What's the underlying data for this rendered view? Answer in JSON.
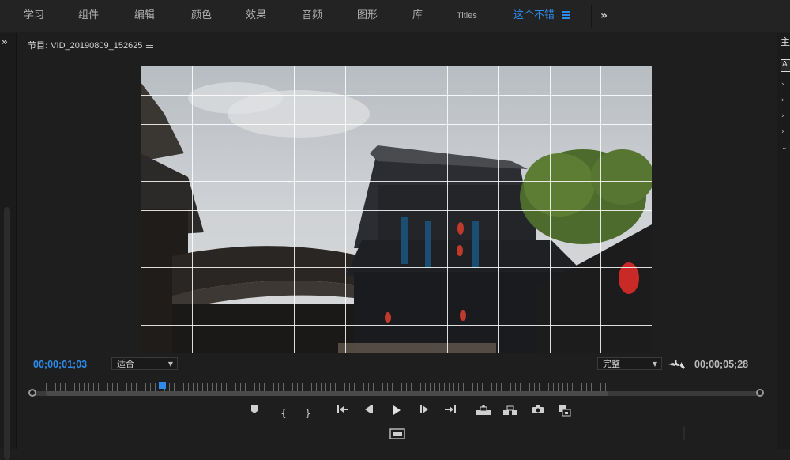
{
  "workspaces": [
    {
      "label": "学习"
    },
    {
      "label": "组件"
    },
    {
      "label": "编辑"
    },
    {
      "label": "颜色"
    },
    {
      "label": "效果"
    },
    {
      "label": "音频"
    },
    {
      "label": "图形"
    },
    {
      "label": "库"
    },
    {
      "label": "Titles"
    },
    {
      "label": "这个不错"
    }
  ],
  "more_workspaces": "»",
  "left_strip": {
    "expand": "»"
  },
  "panel": {
    "title_prefix": "节目: ",
    "title_seq": "VID_20190809_152625"
  },
  "monitor": {
    "current_timecode": "00;00;01;03",
    "duration_timecode": "00;00;05;28",
    "fit_value": "适合",
    "resolution_value": "完整",
    "playhead_fraction": 0.206
  },
  "transport": {
    "in_bracket": "{",
    "out_bracket": "}"
  },
  "right_strip": {
    "top_label": "主",
    "tab_label": "A"
  },
  "colors": {
    "accent": "#2d8ceb",
    "panel_bg": "#1e1e1e",
    "grid": "#ffffff"
  }
}
